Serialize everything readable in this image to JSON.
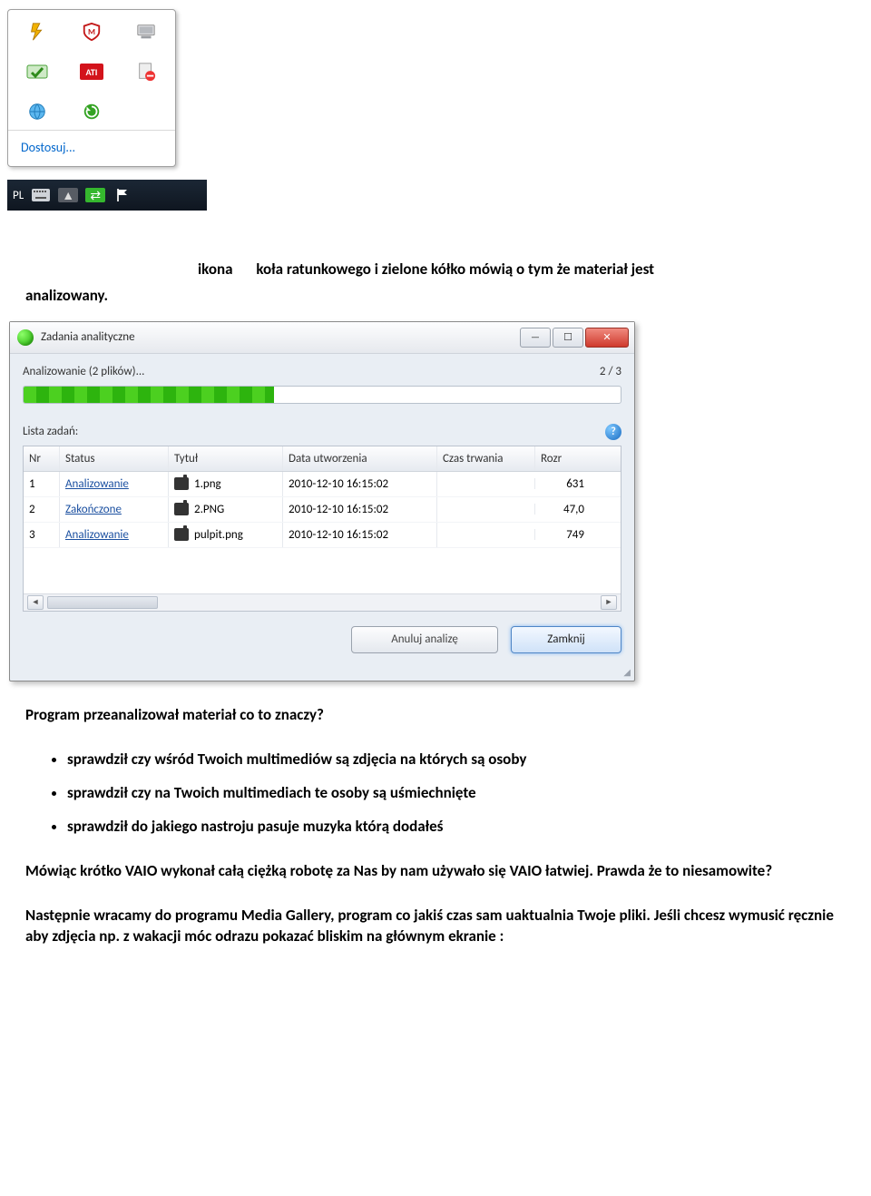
{
  "tray": {
    "customize_label": "Dostosuj...",
    "icons": [
      "lightning-icon",
      "shield-m-icon",
      "device-icon",
      "check-icon",
      "ati-icon",
      "blocked-icon",
      "globe-icon",
      "refresh-green-icon"
    ]
  },
  "taskbar": {
    "lang": "PL"
  },
  "caption": {
    "word_ikona": "ikona",
    "rest": "koła ratunkowego i zielone kółko mówią o tym że materiał jest",
    "cont": "analizowany."
  },
  "dialog": {
    "title": "Zadania analityczne",
    "progress_label": "Analizowanie (2 plików)...",
    "progress_count": "2 / 3",
    "list_label": "Lista zadań:",
    "columns": {
      "nr": "Nr",
      "status": "Status",
      "title": "Tytuł",
      "created": "Data utworzenia",
      "duration": "Czas trwania",
      "size": "Rozr"
    },
    "rows": [
      {
        "nr": "1",
        "status": "Analizowanie",
        "title": "1.png",
        "created": "2010-12-10 16:15:02",
        "duration": "",
        "size": "631"
      },
      {
        "nr": "2",
        "status": "Zakończone",
        "title": "2.PNG",
        "created": "2010-12-10 16:15:02",
        "duration": "",
        "size": "47,0"
      },
      {
        "nr": "3",
        "status": "Analizowanie",
        "title": "pulpit.png",
        "created": "2010-12-10 16:15:02",
        "duration": "",
        "size": "749"
      }
    ],
    "cancel_btn": "Anuluj analizę",
    "close_btn": "Zamknij"
  },
  "text": {
    "q1": "Program przeanalizował materiał co to znaczy?",
    "b1": "sprawdził czy wśród Twoich multimediów są zdjęcia na których są osoby",
    "b2": "sprawdził czy na Twoich multimediach te osoby są uśmiechnięte",
    "b3": "sprawdził do jakiego nastroju pasuje muzyka którą dodałeś",
    "p1": "Mówiąc krótko VAIO wykonał całą ciężką robotę za Nas by nam używało się VAIO łatwiej. Prawda że to niesamowite?",
    "p2": "Następnie wracamy do programu Media Gallery, program co jakiś czas sam uaktualnia Twoje pliki. Jeśli chcesz wymusić ręcznie aby zdjęcia np. z wakacji móc odrazu pokazać bliskim na głównym ekranie :"
  }
}
